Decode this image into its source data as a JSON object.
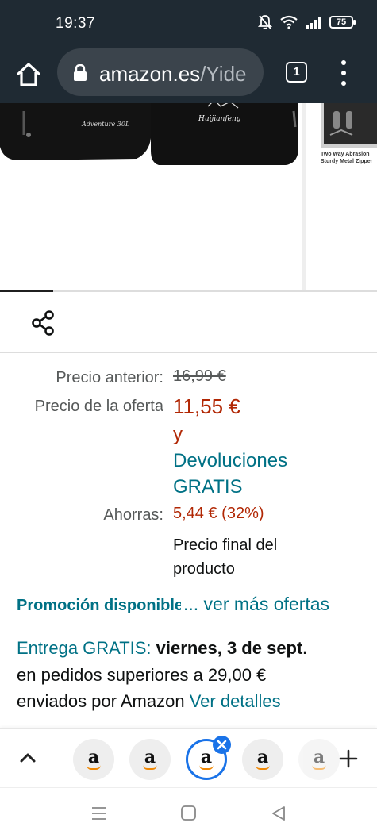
{
  "status": {
    "time": "19:37",
    "battery": "75"
  },
  "browser": {
    "url_domain": "amazon.es",
    "url_path": "/Yide",
    "tab_count": "1"
  },
  "gallery": {
    "next_caption_line1": "Two Way Abrasion",
    "next_caption_line2": "Sturdy Metal Zipper",
    "progress_fraction": 0.14
  },
  "pricing": {
    "previous_label": "Precio anterior:",
    "previous_value": "16,99 €",
    "deal_label": "Precio de la oferta",
    "deal_value": "11,55 €",
    "and_text": "y",
    "returns_text": "Devoluciones GRATIS",
    "savings_label": "Ahorras:",
    "savings_value": "5,44 € (32%)",
    "final_price_note": "Precio final del producto"
  },
  "promotion": {
    "label": "Promoción disponible",
    "more_offers": "... ver más ofertas"
  },
  "delivery": {
    "free_label": "Entrega GRATIS:",
    "date": "viernes, 3 de sept.",
    "condition": "en pedidos superiores a 29,00 €",
    "shipper": "enviados por Amazon",
    "details_link": "Ver detalles"
  },
  "tab_strip": {
    "tab_letter": "a"
  },
  "colors": {
    "price_red": "#b12704",
    "link_teal": "#007185",
    "toolbar_dark": "#1f2a33",
    "tab_active_blue": "#1a73e8",
    "amazon_orange": "#f08804"
  }
}
